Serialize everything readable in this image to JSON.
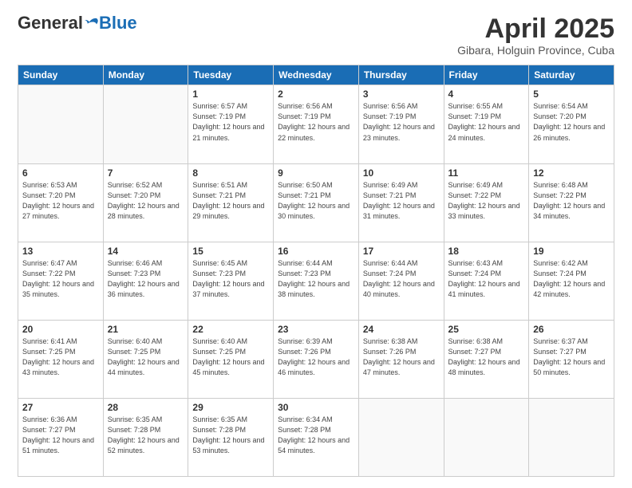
{
  "header": {
    "logo": {
      "general": "General",
      "blue": "Blue",
      "tagline": ""
    },
    "title": "April 2025",
    "subtitle": "Gibara, Holguin Province, Cuba"
  },
  "weekdays": [
    "Sunday",
    "Monday",
    "Tuesday",
    "Wednesday",
    "Thursday",
    "Friday",
    "Saturday"
  ],
  "weeks": [
    [
      {
        "day": "",
        "sunrise": "",
        "sunset": "",
        "daylight": ""
      },
      {
        "day": "",
        "sunrise": "",
        "sunset": "",
        "daylight": ""
      },
      {
        "day": "1",
        "sunrise": "Sunrise: 6:57 AM",
        "sunset": "Sunset: 7:19 PM",
        "daylight": "Daylight: 12 hours and 21 minutes."
      },
      {
        "day": "2",
        "sunrise": "Sunrise: 6:56 AM",
        "sunset": "Sunset: 7:19 PM",
        "daylight": "Daylight: 12 hours and 22 minutes."
      },
      {
        "day": "3",
        "sunrise": "Sunrise: 6:56 AM",
        "sunset": "Sunset: 7:19 PM",
        "daylight": "Daylight: 12 hours and 23 minutes."
      },
      {
        "day": "4",
        "sunrise": "Sunrise: 6:55 AM",
        "sunset": "Sunset: 7:19 PM",
        "daylight": "Daylight: 12 hours and 24 minutes."
      },
      {
        "day": "5",
        "sunrise": "Sunrise: 6:54 AM",
        "sunset": "Sunset: 7:20 PM",
        "daylight": "Daylight: 12 hours and 26 minutes."
      }
    ],
    [
      {
        "day": "6",
        "sunrise": "Sunrise: 6:53 AM",
        "sunset": "Sunset: 7:20 PM",
        "daylight": "Daylight: 12 hours and 27 minutes."
      },
      {
        "day": "7",
        "sunrise": "Sunrise: 6:52 AM",
        "sunset": "Sunset: 7:20 PM",
        "daylight": "Daylight: 12 hours and 28 minutes."
      },
      {
        "day": "8",
        "sunrise": "Sunrise: 6:51 AM",
        "sunset": "Sunset: 7:21 PM",
        "daylight": "Daylight: 12 hours and 29 minutes."
      },
      {
        "day": "9",
        "sunrise": "Sunrise: 6:50 AM",
        "sunset": "Sunset: 7:21 PM",
        "daylight": "Daylight: 12 hours and 30 minutes."
      },
      {
        "day": "10",
        "sunrise": "Sunrise: 6:49 AM",
        "sunset": "Sunset: 7:21 PM",
        "daylight": "Daylight: 12 hours and 31 minutes."
      },
      {
        "day": "11",
        "sunrise": "Sunrise: 6:49 AM",
        "sunset": "Sunset: 7:22 PM",
        "daylight": "Daylight: 12 hours and 33 minutes."
      },
      {
        "day": "12",
        "sunrise": "Sunrise: 6:48 AM",
        "sunset": "Sunset: 7:22 PM",
        "daylight": "Daylight: 12 hours and 34 minutes."
      }
    ],
    [
      {
        "day": "13",
        "sunrise": "Sunrise: 6:47 AM",
        "sunset": "Sunset: 7:22 PM",
        "daylight": "Daylight: 12 hours and 35 minutes."
      },
      {
        "day": "14",
        "sunrise": "Sunrise: 6:46 AM",
        "sunset": "Sunset: 7:23 PM",
        "daylight": "Daylight: 12 hours and 36 minutes."
      },
      {
        "day": "15",
        "sunrise": "Sunrise: 6:45 AM",
        "sunset": "Sunset: 7:23 PM",
        "daylight": "Daylight: 12 hours and 37 minutes."
      },
      {
        "day": "16",
        "sunrise": "Sunrise: 6:44 AM",
        "sunset": "Sunset: 7:23 PM",
        "daylight": "Daylight: 12 hours and 38 minutes."
      },
      {
        "day": "17",
        "sunrise": "Sunrise: 6:44 AM",
        "sunset": "Sunset: 7:24 PM",
        "daylight": "Daylight: 12 hours and 40 minutes."
      },
      {
        "day": "18",
        "sunrise": "Sunrise: 6:43 AM",
        "sunset": "Sunset: 7:24 PM",
        "daylight": "Daylight: 12 hours and 41 minutes."
      },
      {
        "day": "19",
        "sunrise": "Sunrise: 6:42 AM",
        "sunset": "Sunset: 7:24 PM",
        "daylight": "Daylight: 12 hours and 42 minutes."
      }
    ],
    [
      {
        "day": "20",
        "sunrise": "Sunrise: 6:41 AM",
        "sunset": "Sunset: 7:25 PM",
        "daylight": "Daylight: 12 hours and 43 minutes."
      },
      {
        "day": "21",
        "sunrise": "Sunrise: 6:40 AM",
        "sunset": "Sunset: 7:25 PM",
        "daylight": "Daylight: 12 hours and 44 minutes."
      },
      {
        "day": "22",
        "sunrise": "Sunrise: 6:40 AM",
        "sunset": "Sunset: 7:25 PM",
        "daylight": "Daylight: 12 hours and 45 minutes."
      },
      {
        "day": "23",
        "sunrise": "Sunrise: 6:39 AM",
        "sunset": "Sunset: 7:26 PM",
        "daylight": "Daylight: 12 hours and 46 minutes."
      },
      {
        "day": "24",
        "sunrise": "Sunrise: 6:38 AM",
        "sunset": "Sunset: 7:26 PM",
        "daylight": "Daylight: 12 hours and 47 minutes."
      },
      {
        "day": "25",
        "sunrise": "Sunrise: 6:38 AM",
        "sunset": "Sunset: 7:27 PM",
        "daylight": "Daylight: 12 hours and 48 minutes."
      },
      {
        "day": "26",
        "sunrise": "Sunrise: 6:37 AM",
        "sunset": "Sunset: 7:27 PM",
        "daylight": "Daylight: 12 hours and 50 minutes."
      }
    ],
    [
      {
        "day": "27",
        "sunrise": "Sunrise: 6:36 AM",
        "sunset": "Sunset: 7:27 PM",
        "daylight": "Daylight: 12 hours and 51 minutes."
      },
      {
        "day": "28",
        "sunrise": "Sunrise: 6:35 AM",
        "sunset": "Sunset: 7:28 PM",
        "daylight": "Daylight: 12 hours and 52 minutes."
      },
      {
        "day": "29",
        "sunrise": "Sunrise: 6:35 AM",
        "sunset": "Sunset: 7:28 PM",
        "daylight": "Daylight: 12 hours and 53 minutes."
      },
      {
        "day": "30",
        "sunrise": "Sunrise: 6:34 AM",
        "sunset": "Sunset: 7:28 PM",
        "daylight": "Daylight: 12 hours and 54 minutes."
      },
      {
        "day": "",
        "sunrise": "",
        "sunset": "",
        "daylight": ""
      },
      {
        "day": "",
        "sunrise": "",
        "sunset": "",
        "daylight": ""
      },
      {
        "day": "",
        "sunrise": "",
        "sunset": "",
        "daylight": ""
      }
    ]
  ]
}
